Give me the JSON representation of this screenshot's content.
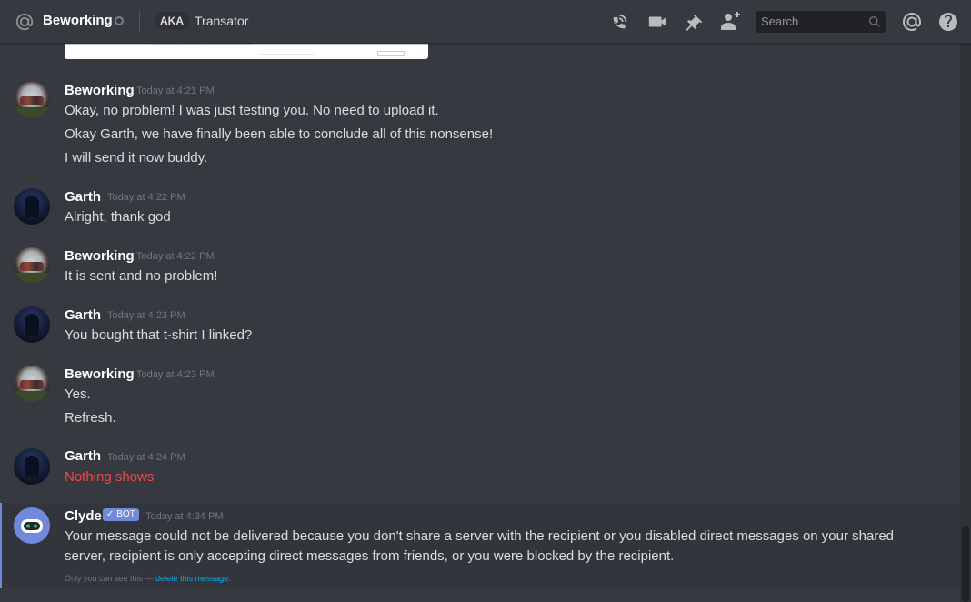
{
  "header": {
    "channel_name": "Beworking",
    "aka_label": "AKA",
    "nickname": "Transator",
    "search_placeholder": "Search"
  },
  "messages": [
    {
      "author": "Beworking",
      "timestamp": "Today at 4:21 PM",
      "lines": [
        "Okay, no problem! I was just testing you. No need to upload it.",
        "Okay Garth, we have finally been able to conclude all of this nonsense!",
        "I will send it now buddy."
      ]
    },
    {
      "author": "Garth",
      "timestamp": "Today at 4:22 PM",
      "lines": [
        "Alright, thank god"
      ]
    },
    {
      "author": "Beworking",
      "timestamp": "Today at 4:22 PM",
      "lines": [
        "It is sent and no problem!"
      ]
    },
    {
      "author": "Garth",
      "timestamp": "Today at 4:23 PM",
      "lines": [
        "You bought that t-shirt I linked?"
      ]
    },
    {
      "author": "Beworking",
      "timestamp": "Today at 4:23 PM",
      "lines": [
        "Yes.",
        "Refresh."
      ]
    },
    {
      "author": "Garth",
      "timestamp": "Today at 4:24 PM",
      "lines": [
        "Nothing shows"
      ]
    },
    {
      "author": "Clyde",
      "bot_tag": "BOT",
      "timestamp": "Today at 4:34 PM",
      "lines": [
        "Your message could not be delivered because you don't share a server with the recipient or you disabled direct messages on your shared",
        "server, recipient is only accepting direct messages from friends, or you were blocked by the recipient."
      ]
    }
  ],
  "clyde_notice": {
    "text": "Only you can see this — ",
    "link": "delete this message."
  },
  "colors": {
    "background": "#36393f",
    "accent": "#7289da",
    "error_text": "#f04747",
    "link": "#00b0f4"
  },
  "icons": [
    "at-icon",
    "status-icon",
    "call-icon",
    "video-icon",
    "pin-icon",
    "add-friend-icon",
    "search-icon",
    "mentions-icon",
    "help-icon",
    "bot-check-icon"
  ]
}
